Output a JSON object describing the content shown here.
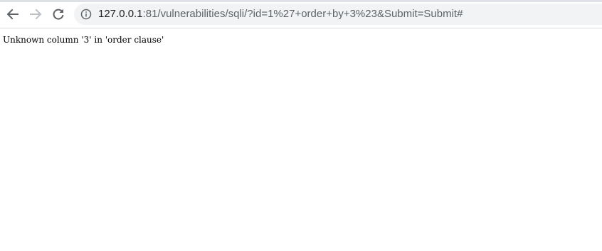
{
  "browser": {
    "nav": {
      "back_icon": "arrow-left-icon",
      "forward_icon": "arrow-right-icon",
      "reload_icon": "reload-icon"
    },
    "address_bar": {
      "info_icon": "info-circle-icon",
      "host": "127.0.0.1",
      "rest": ":81/vulnerabilities/sqli/?id=1%27+order+by+3%23&Submit=Submit#"
    }
  },
  "page": {
    "message": "Unknown column '3' in 'order clause'"
  }
}
